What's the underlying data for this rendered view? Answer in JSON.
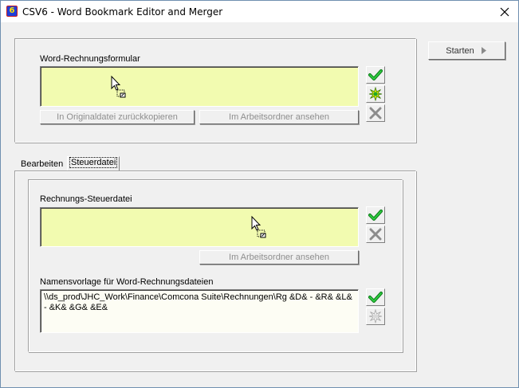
{
  "window": {
    "title": "CSV6 - Word Bookmark Editor and Merger",
    "app_icon_glyph": "6"
  },
  "start_button": {
    "label": "Starten"
  },
  "invoice_form": {
    "label": "Word-Rechnungsformular",
    "copy_back_button": "In Originaldatei zurückkopieren",
    "view_in_workdir_button": "Im Arbeitsordner ansehen"
  },
  "tabs": [
    {
      "label": "Bearbeiten",
      "active": false
    },
    {
      "label": "Steuerdatei",
      "active": true
    }
  ],
  "control_file": {
    "label": "Rechnungs-Steuerdatei",
    "view_in_workdir_button": "Im Arbeitsordner ansehen"
  },
  "name_template": {
    "label": "Namensvorlage für Word-Rechnungsdateien",
    "value": "\\\\ds_prod\\JHC_Work\\Finance\\Comcona Suite\\Rechnungen\\Rg &D& - &R& &L& - &K& &G& &E&"
  },
  "colors": {
    "drop_area": "#f2fbb0",
    "check_green": "#1fa82a",
    "delete_gray": "#8c8c8c",
    "star_yellow": "#e8f000"
  },
  "icons": [
    "app-icon",
    "close-icon",
    "play-arrow-icon",
    "check-icon",
    "new-star-icon",
    "delete-x-icon",
    "drag-cursor-icon"
  ]
}
